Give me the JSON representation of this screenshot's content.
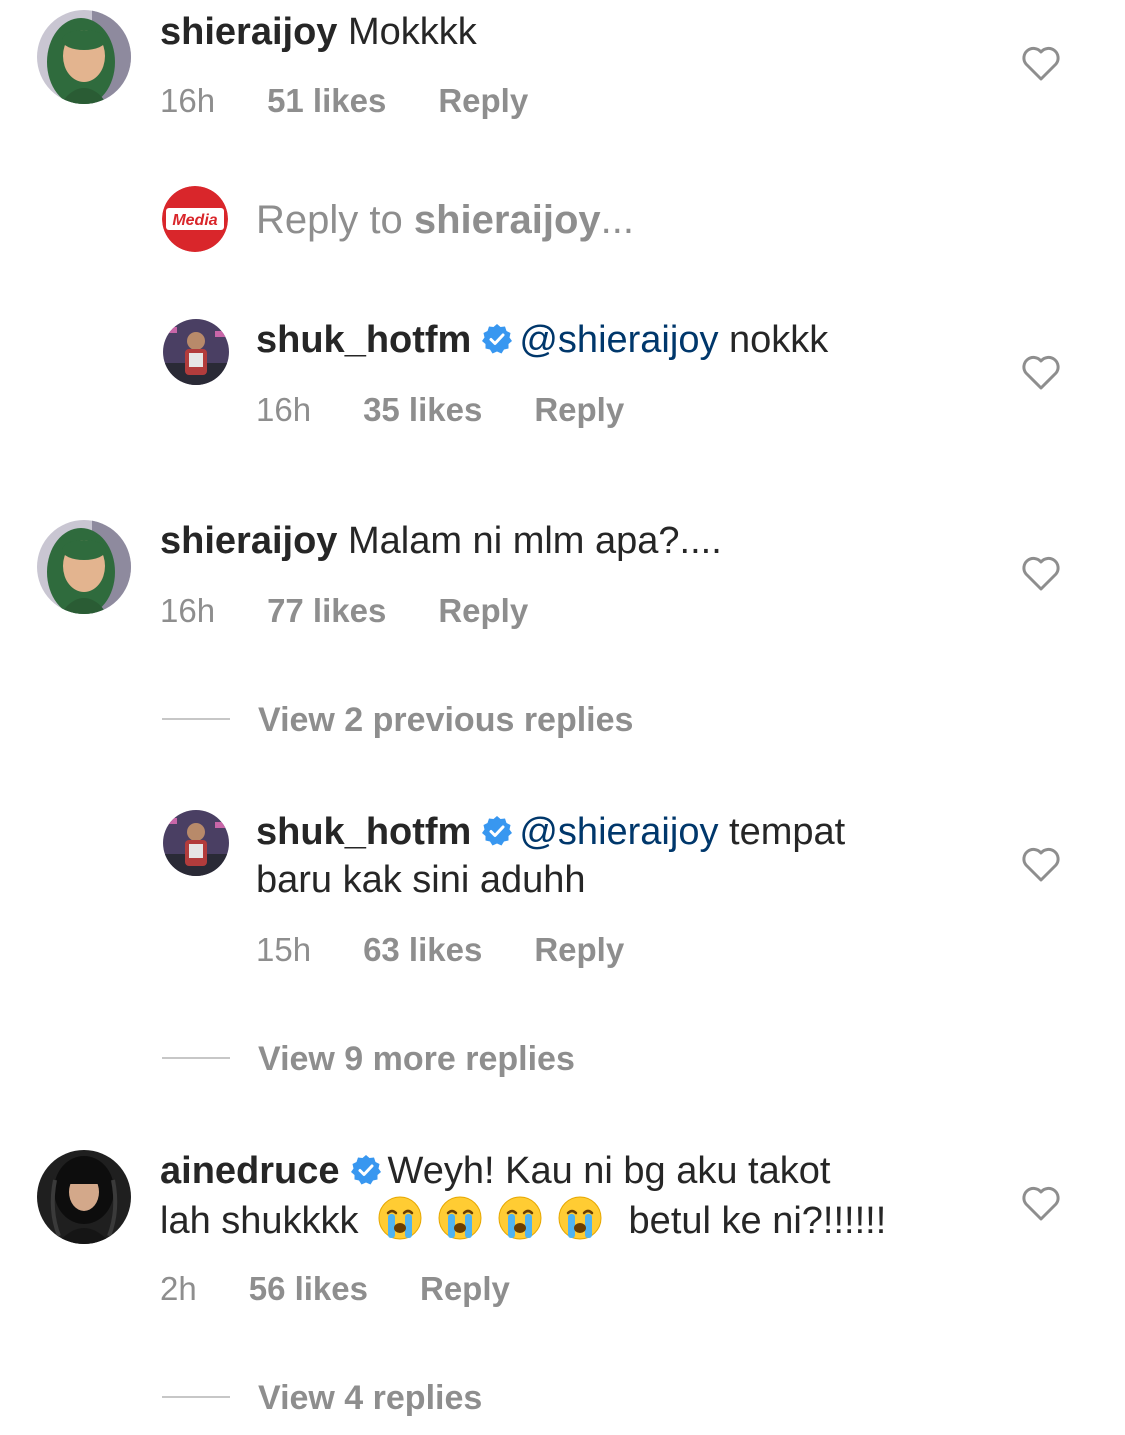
{
  "comments": [
    {
      "username": "shieraijoy",
      "text": "Mokkkk",
      "time": "16h",
      "likes": "51 likes",
      "reply": "Reply",
      "avatar_icon": "user-avatar-hijab-icon"
    },
    {
      "username": "shuk_hotfm",
      "verified": true,
      "mention": "@shieraijoy",
      "text": "nokkk",
      "time": "16h",
      "likes": "35 likes",
      "reply": "Reply",
      "avatar_icon": "user-avatar-stage-icon"
    },
    {
      "username": "shieraijoy",
      "text": "Malam ni mlm apa?....",
      "time": "16h",
      "likes": "77 likes",
      "reply": "Reply",
      "avatar_icon": "user-avatar-hijab-icon"
    },
    {
      "username": "shuk_hotfm",
      "verified": true,
      "mention": "@shieraijoy",
      "text_line1": "tempat",
      "text_line2": "baru kak sini aduhh",
      "time": "15h",
      "likes": "63 likes",
      "reply": "Reply",
      "avatar_icon": "user-avatar-stage-icon"
    },
    {
      "username": "ainedruce",
      "verified": true,
      "text_line1": "Weyh! Kau ni bg aku takot",
      "text_line2_start": "lah shukkkk",
      "emojis": [
        "crying-face",
        "crying-face",
        "crying-face",
        "crying-face"
      ],
      "text_line2_end": "betul ke ni?!!!!!!",
      "time": "2h",
      "likes": "56 likes",
      "reply": "Reply",
      "avatar_icon": "user-avatar-woman-icon"
    }
  ],
  "reply_composer": {
    "prefix": "Reply to ",
    "target": "shieraijoy",
    "suffix": "...",
    "avatar_label": "Media"
  },
  "view_links": {
    "previous": "View 2 previous replies",
    "more": "View 9 more replies",
    "replies": "View 4 replies"
  },
  "colors": {
    "text": "#262626",
    "secondary": "#8e8e8e",
    "mention": "#00376b",
    "verified": "#3897f0",
    "media_red": "#d9262b"
  }
}
